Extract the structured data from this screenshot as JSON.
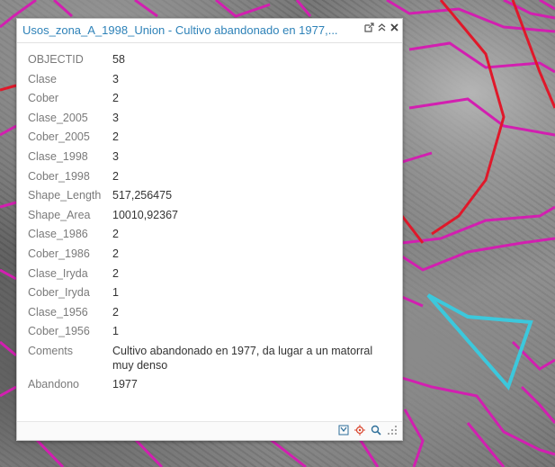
{
  "popup": {
    "title": "Usos_zona_A_1998_Union - Cultivo abandonado en 1977,...",
    "header_icons": [
      "external-link-icon",
      "chevron-up-double-icon",
      "close-icon"
    ],
    "footer_icons": [
      "filter-icon",
      "locate-icon",
      "zoom-icon",
      "resize-handle-icon"
    ],
    "fields": [
      {
        "key": "OBJECTID",
        "value": "58"
      },
      {
        "key": "Clase",
        "value": "3"
      },
      {
        "key": "Cober",
        "value": "2"
      },
      {
        "key": "Clase_2005",
        "value": "3"
      },
      {
        "key": "Cober_2005",
        "value": "2"
      },
      {
        "key": "Clase_1998",
        "value": "3"
      },
      {
        "key": "Cober_1998",
        "value": "2"
      },
      {
        "key": "Shape_Length",
        "value": "517,256475"
      },
      {
        "key": "Shape_Area",
        "value": "10010,92367"
      },
      {
        "key": "Clase_1986",
        "value": "2"
      },
      {
        "key": "Cober_1986",
        "value": "2"
      },
      {
        "key": "Clase_Iryda",
        "value": "2"
      },
      {
        "key": "Cober_Iryda",
        "value": "1"
      },
      {
        "key": "Clase_1956",
        "value": "2"
      },
      {
        "key": "Cober_1956",
        "value": "1"
      },
      {
        "key": "Coments",
        "value": "Cultivo abandonado en 1977, da lugar a un matorral muy denso"
      },
      {
        "key": "Abandono",
        "value": "1977"
      }
    ]
  },
  "colors": {
    "title": "#2e82b8",
    "polygon_magenta": "#d21fb0",
    "polygon_red": "#e0182a",
    "selection_cyan": "#3cc8dc"
  }
}
